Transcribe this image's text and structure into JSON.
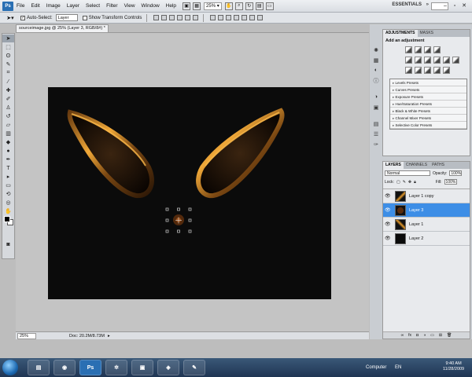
{
  "menubar": {
    "logo": "Ps",
    "items": [
      "File",
      "Edit",
      "Image",
      "Layer",
      "Select",
      "Filter",
      "View",
      "Window",
      "Help"
    ],
    "zoom": "25%",
    "workspace": "ESSENTIALS"
  },
  "options": {
    "auto_select_label": "Auto-Select:",
    "auto_select_value": "Layer",
    "show_transform_label": "Show Transform Controls"
  },
  "document": {
    "tab_title": "sourceimage.jpg @ 25% (Layer 3, RGB/8#) *",
    "status_zoom": "25%",
    "status_doc": "Doc: 20.2M/8.73M"
  },
  "adjustments": {
    "tabs": [
      "ADJUSTMENTS",
      "MASKS"
    ],
    "title": "Add an adjustment",
    "presets": [
      "Levels Presets",
      "Curves Presets",
      "Exposure Presets",
      "Hue/Saturation Presets",
      "Black & White Presets",
      "Channel Mixer Presets",
      "Selective Color Presets"
    ]
  },
  "layers": {
    "tabs": [
      "LAYERS",
      "CHANNELS",
      "PATHS"
    ],
    "blend_mode": "Normal",
    "opacity_label": "Opacity:",
    "opacity": "100%",
    "lock_label": "Lock:",
    "fill_label": "Fill:",
    "fill": "100%",
    "items": [
      {
        "name": "Layer 1 copy",
        "selected": false
      },
      {
        "name": "Layer 3",
        "selected": true
      },
      {
        "name": "Layer 1",
        "selected": false
      },
      {
        "name": "Layer 2",
        "selected": false
      }
    ]
  },
  "taskbar": {
    "ps_label": "Ps",
    "computer": "Computer",
    "lang": "EN",
    "time": "9:40 AM",
    "date": "11/28/2009"
  },
  "colors": {
    "selection": "#3d8ee6",
    "canvas_bg": "#0b0b0b",
    "glow": "#e59a2b"
  }
}
